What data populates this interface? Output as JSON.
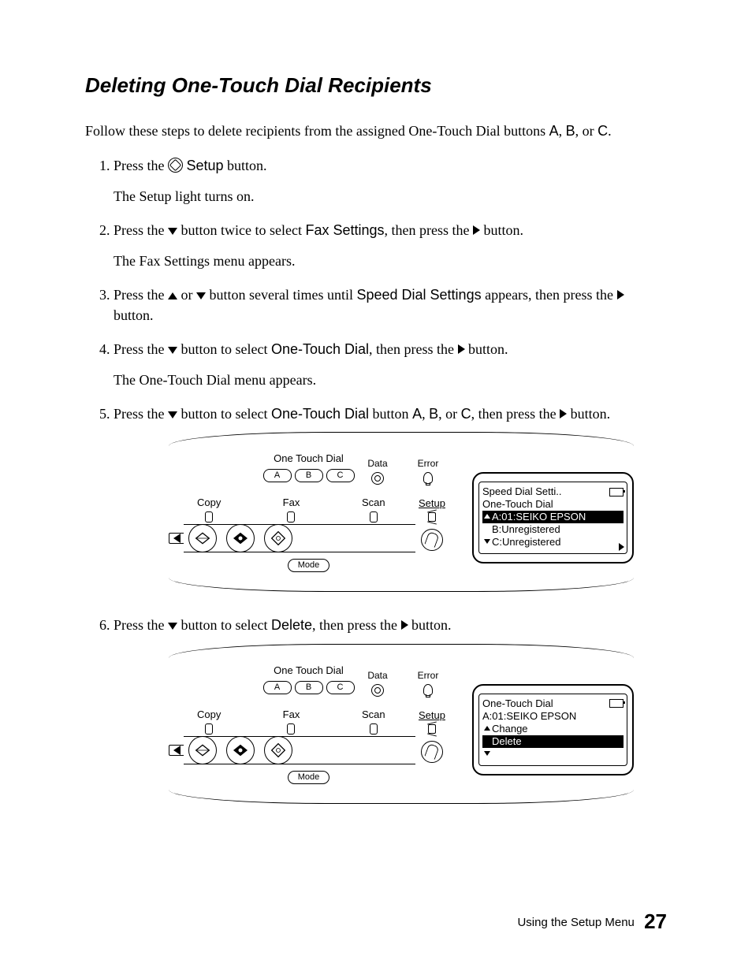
{
  "section_title": "Deleting One-Touch Dial Recipients",
  "intro": {
    "pre": "Follow these steps to delete recipients from the assigned One-Touch Dial buttons ",
    "a": "A",
    "sep1": ", ",
    "b": "B",
    "sep2": ", or ",
    "c": "C",
    "tail": "."
  },
  "steps": {
    "s1": {
      "pre": "Press the ",
      "setup": "Setup",
      "post": " button.",
      "sub": "The Setup light turns on."
    },
    "s2": {
      "pre": "Press the ",
      "mid1": " button twice to select ",
      "fax_settings": "Fax Settings",
      "mid2": ", then press the ",
      "end": " button.",
      "sub": "The Fax Settings menu appears."
    },
    "s3": {
      "pre": "Press the ",
      "or": " or ",
      "mid": " button several times until ",
      "sds": "Speed Dial Settings",
      "post1": " appears, then press the ",
      "end": " button."
    },
    "s4": {
      "pre": "Press the ",
      "mid1": " button to select ",
      "otd": "One-Touch Dial",
      "mid2": ", then press the ",
      "end": " button.",
      "sub": "The One-Touch Dial menu appears."
    },
    "s5": {
      "pre": "Press the ",
      "mid1": " button to select ",
      "otd": "One-Touch Dial",
      "mid2": " button ",
      "a": "A",
      "sep1": ", ",
      "b": "B",
      "sep2": ", or ",
      "c": "C",
      "mid3": ", then press the ",
      "end": " button."
    },
    "s6": {
      "pre": "Press the ",
      "mid1": " button to select ",
      "del": "Delete",
      "mid2": ", then press the ",
      "end": " button."
    }
  },
  "panel_labels": {
    "one_touch_dial": "One Touch Dial",
    "a": "A",
    "b": "B",
    "c": "C",
    "data": "Data",
    "error": "Error",
    "copy": "Copy",
    "fax": "Fax",
    "scan": "Scan",
    "setup": "Setup",
    "mode": "Mode"
  },
  "lcd1": {
    "title": "Speed Dial Setti..",
    "sub": "One-Touch Dial",
    "line_a": "A:01:SEIKO EPSON",
    "line_b": "B:Unregistered",
    "line_c": "C:Unregistered"
  },
  "lcd2": {
    "title": "One-Touch Dial",
    "sub": "A:01:SEIKO EPSON",
    "line_change": "Change",
    "line_delete": "Delete"
  },
  "footer": {
    "label": "Using the Setup Menu",
    "page": "27"
  }
}
